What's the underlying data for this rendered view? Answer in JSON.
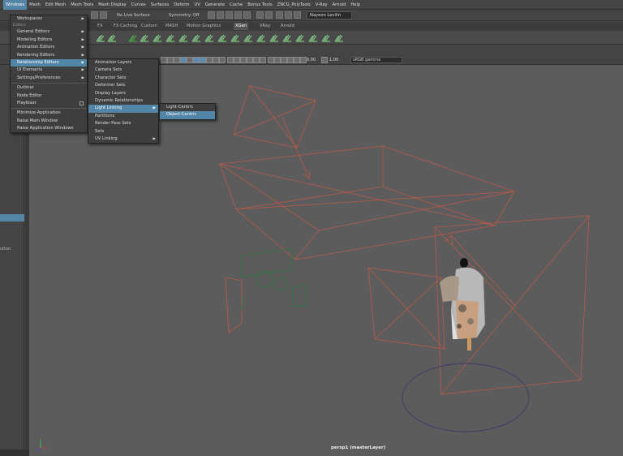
{
  "menubar": {
    "items": [
      "Windows",
      "Mesh",
      "Edit Mesh",
      "Mesh Tools",
      "Mesh Display",
      "Curves",
      "Surfaces",
      "Deform",
      "UV",
      "Generate",
      "Cache",
      "Bonus Tools",
      "ZNCG_PolyTools",
      "V-Ray",
      "Arnold",
      "Help"
    ],
    "active_index": 0
  },
  "statusline": {
    "live_surface": "No Live Surface",
    "symmetry": "Symmetry: Off",
    "user": "Nayeon Levilin"
  },
  "shelf": {
    "tabs": [
      "FX",
      "FX Caching",
      "Custom",
      "MASH",
      "Motion Graphics",
      "XGen",
      "VRay",
      "Arnold"
    ],
    "active_index": 5
  },
  "panel_toolbar": {
    "value1": "0.00",
    "value2": "1.00",
    "color_space": "sRGB gamma"
  },
  "toolbox": {
    "partial_label": "utton"
  },
  "viewport": {
    "camera_label": "persp1 (masterLayer)",
    "colors": {
      "background": "#5c5c5c",
      "light_wire": "#b85a4a",
      "camera_wire": "#2a7a3a",
      "circle": "#3a3a6a"
    }
  },
  "windows_menu": {
    "items": [
      {
        "label": "Workspaces",
        "submenu": true
      },
      {
        "section": "Editors"
      },
      {
        "label": "General Editors",
        "submenu": true
      },
      {
        "label": "Modeling Editors",
        "submenu": true
      },
      {
        "label": "Animation Editors",
        "submenu": true
      },
      {
        "label": "Rendering Editors",
        "submenu": true
      },
      {
        "label": "Relationship Editors",
        "submenu": true,
        "highlighted": true
      },
      {
        "label": "UI Elements",
        "submenu": true
      },
      {
        "label": "Settings/Preferences",
        "submenu": true
      },
      {
        "separator": true
      },
      {
        "label": "Outliner"
      },
      {
        "label": "Node Editor"
      },
      {
        "label": "Playblast",
        "checkbox": true
      },
      {
        "separator": true
      },
      {
        "label": "Minimize Application"
      },
      {
        "label": "Raise Main Window"
      },
      {
        "label": "Raise Application Windows"
      }
    ]
  },
  "relationship_menu": {
    "items": [
      {
        "label": "Animation Layers"
      },
      {
        "label": "Camera Sets"
      },
      {
        "label": "Character Sets"
      },
      {
        "label": "Deformer Sets"
      },
      {
        "label": "Display Layers"
      },
      {
        "label": "Dynamic Relationships"
      },
      {
        "label": "Light Linking",
        "submenu": true,
        "highlighted": true
      },
      {
        "label": "Partitions"
      },
      {
        "label": "Render Pass Sets"
      },
      {
        "label": "Sets"
      },
      {
        "label": "UV Linking",
        "submenu": true
      }
    ]
  },
  "light_linking_menu": {
    "items": [
      {
        "label": "Light-Centric"
      },
      {
        "label": "Object-Centric",
        "highlighted": true
      }
    ]
  },
  "icons": {
    "arrow": "▶",
    "checkbox": "checkbox-icon"
  }
}
